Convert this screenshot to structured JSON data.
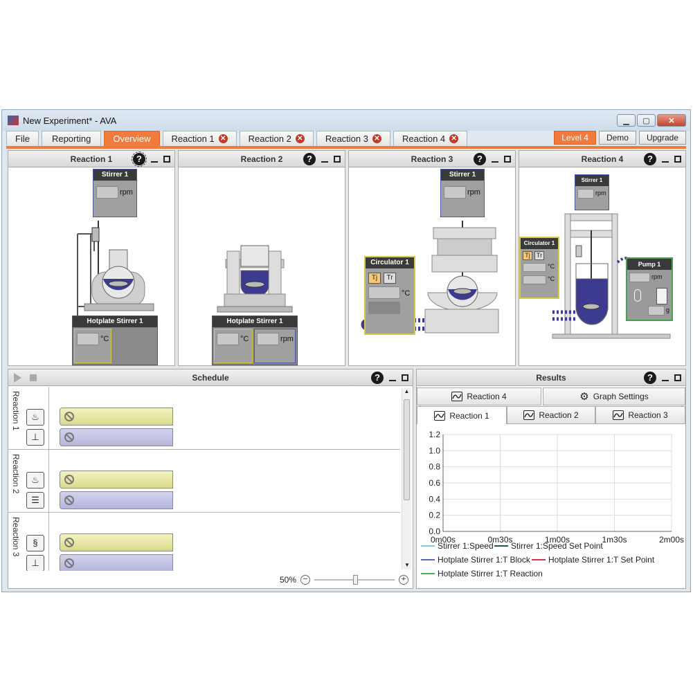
{
  "window": {
    "title": "New Experiment* - AVA"
  },
  "menu": {
    "file": "File",
    "reporting": "Reporting",
    "overview": "Overview",
    "reaction_tabs": [
      "Reaction 1",
      "Reaction 2",
      "Reaction 3",
      "Reaction 4"
    ],
    "level": "Level 4",
    "demo": "Demo",
    "upgrade": "Upgrade"
  },
  "reactions": [
    {
      "title": "Reaction 1",
      "stirrer": "Stirrer 1",
      "hotplate": "Hotplate Stirrer 1"
    },
    {
      "title": "Reaction 2",
      "hotplate": "Hotplate Stirrer 1"
    },
    {
      "title": "Reaction 3",
      "stirrer": "Stirrer 1",
      "circulator": "Circulator 1"
    },
    {
      "title": "Reaction 4",
      "stirrer": "Stirrer 1",
      "circulator": "Circulator 1",
      "pump": "Pump 1"
    }
  ],
  "units": {
    "rpm": "rpm",
    "celsius": "°C",
    "gram": "g",
    "tj": "Tj",
    "tr": "Tr"
  },
  "schedule": {
    "title": "Schedule",
    "rows": [
      "Reaction 1",
      "Reaction 2",
      "Reaction 3"
    ],
    "zoom": "50%"
  },
  "results": {
    "title": "Results",
    "tab_reaction4": "Reaction 4",
    "graph_settings": "Graph Settings",
    "tabs": [
      "Reaction 1",
      "Reaction 2",
      "Reaction 3"
    ],
    "legend": [
      {
        "name": "Stirrer 1:Speed",
        "color": "#7ec8e3"
      },
      {
        "name": "Stirrer 1:Speed Set Point",
        "color": "#1e5c3a"
      },
      {
        "name": "Hotplate Stirrer 1:T Block",
        "color": "#4a6fb5"
      },
      {
        "name": "Hotplate Stirrer 1:T Set Point",
        "color": "#d9323a"
      },
      {
        "name": "Hotplate Stirrer 1:T Reaction",
        "color": "#4caf50"
      }
    ]
  },
  "chart_data": {
    "type": "line",
    "x_ticks": [
      "0m00s",
      "0m30s",
      "1m00s",
      "1m30s",
      "2m00s"
    ],
    "y_ticks": [
      "0.0",
      "0.2",
      "0.4",
      "0.6",
      "0.8",
      "1.0",
      "1.2"
    ],
    "ylim": [
      0,
      1.2
    ],
    "grid": true,
    "series": []
  },
  "colors": {
    "accent": "#f07b3b",
    "vessel": "#3d3b8f"
  }
}
